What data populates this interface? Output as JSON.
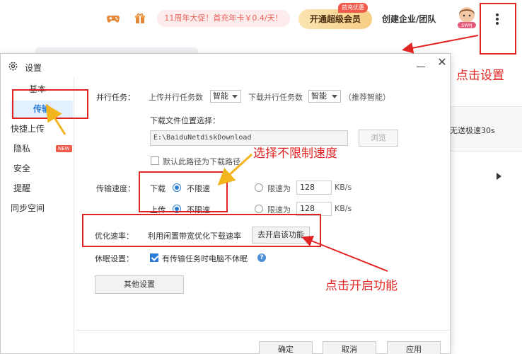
{
  "topbar": {
    "game_icon": "gamepad-icon",
    "gift_icon": "gift-icon",
    "promo_text": "11周年大促！首充年卡￥0.4/天！",
    "vip_button": "开通超级会员",
    "vip_badge": "首充优惠",
    "corp_link": "创建企业/团队",
    "avatar_badge": "SWPJ",
    "more_icon": "kebab-menu-icon"
  },
  "background_app": {
    "speed_text": "无送极速30s"
  },
  "dialog": {
    "title": "设置",
    "sidebar": [
      "基本",
      "传输",
      "快捷上传",
      "隐私",
      "安全",
      "提醒",
      "同步空间"
    ],
    "active_item": "传输",
    "new_tag": "NEW",
    "parallel": {
      "label": "并行任务：",
      "upload_label": "上传并行任务数",
      "upload_value": "智能",
      "download_label": "下载并行任务数",
      "download_value": "智能",
      "hint": "（推荐智能）"
    },
    "download_path": {
      "label": "下载文件位置选择：",
      "value": "E:\\BaiduNetdiskDownload",
      "browse": "浏览",
      "default_checkbox": "默认此路径为下载路径"
    },
    "speed": {
      "label": "传输速度：",
      "download": "下载",
      "upload": "上传",
      "unlimited": "不限速",
      "limit": "限速为",
      "download_limit_value": "128",
      "upload_limit_value": "128",
      "unit": "KB/s"
    },
    "optimize": {
      "label": "优化速率：",
      "text": "利用闲置带宽优化下载速率",
      "button": "去开启该功能"
    },
    "sleep": {
      "label": "休眠设置：",
      "checkbox": "有传输任务时电脑不休眠"
    },
    "other_settings": "其他设置",
    "buttons": {
      "ok": "确定",
      "cancel": "取消",
      "apply": "应用"
    }
  },
  "annotations": {
    "click_settings": "点击设置",
    "choose_unlimited": "选择不限制速度",
    "click_enable": "点击开启功能",
    "color": "#e02424"
  }
}
